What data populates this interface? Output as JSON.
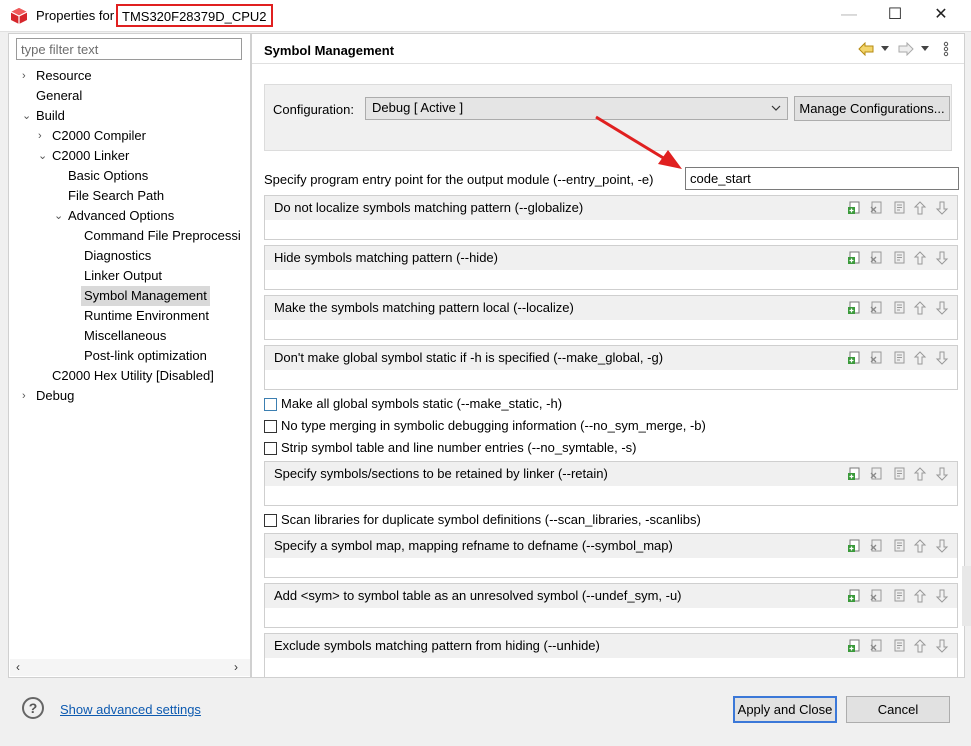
{
  "window": {
    "title_prefix": "Properties for",
    "title_target": "TMS320F28379D_CPU2",
    "minimize": "—",
    "maximize": "☐",
    "close": "✕"
  },
  "nav": {
    "filter_placeholder": "type filter text",
    "items": [
      {
        "label": "Resource",
        "arrow": "›"
      },
      {
        "label": "General"
      },
      {
        "label": "Build",
        "arrow": "⌄"
      },
      {
        "label": "C2000 Compiler",
        "arrow": "›"
      },
      {
        "label": "C2000 Linker",
        "arrow": "⌄"
      },
      {
        "label": "Basic Options"
      },
      {
        "label": "File Search Path"
      },
      {
        "label": "Advanced Options",
        "arrow": "⌄"
      },
      {
        "label": "Command File Preprocessi"
      },
      {
        "label": "Diagnostics"
      },
      {
        "label": "Linker Output"
      },
      {
        "label": "Symbol Management",
        "selected": true
      },
      {
        "label": "Runtime Environment"
      },
      {
        "label": "Miscellaneous"
      },
      {
        "label": "Post-link optimization"
      },
      {
        "label": "C2000 Hex Utility  [Disabled]"
      },
      {
        "label": "Debug",
        "arrow": "›"
      }
    ],
    "scroll_left": "‹",
    "scroll_right": "›"
  },
  "page": {
    "title": "Symbol Management",
    "configuration_label": "Configuration:",
    "configuration_value": "Debug  [ Active ]",
    "manage_button": "Manage Configurations...",
    "entry_label": "Specify program entry point for the output module (--entry_point, -e)",
    "entry_value": "code_start",
    "groups": [
      {
        "label": "Do not localize symbols matching pattern (--globalize)"
      },
      {
        "label": "Hide symbols matching pattern (--hide)"
      },
      {
        "label": "Make the symbols matching pattern local (--localize)"
      },
      {
        "label": "Don't make global symbol static if -h is specified (--make_global, -g)"
      },
      {
        "label": "Specify symbols/sections to be retained by linker (--retain)"
      },
      {
        "label": "Specify a symbol map, mapping refname to defname (--symbol_map)"
      },
      {
        "label": "Add <sym> to symbol table as an unresolved symbol (--undef_sym, -u)"
      },
      {
        "label": "Exclude symbols matching pattern from hiding (--unhide)"
      }
    ],
    "checks": [
      {
        "label": "Make all global symbols static (--make_static, -h)",
        "checked": false
      },
      {
        "label": "No type merging in symbolic debugging information (--no_sym_merge, -b)",
        "checked": false
      },
      {
        "label": "Strip symbol table and line number entries (--no_symtable, -s)",
        "checked": false
      },
      {
        "label": "Scan libraries for duplicate symbol definitions (--scan_libraries, -scanlibs)",
        "checked": false
      }
    ]
  },
  "footer": {
    "help": "?",
    "advanced_link": "Show advanced settings",
    "apply_close": "Apply and Close",
    "cancel": "Cancel"
  },
  "colors": {
    "highlight_red": "#e02020",
    "link_blue": "#0d5ab0",
    "focus_blue": "#3b78d8"
  }
}
